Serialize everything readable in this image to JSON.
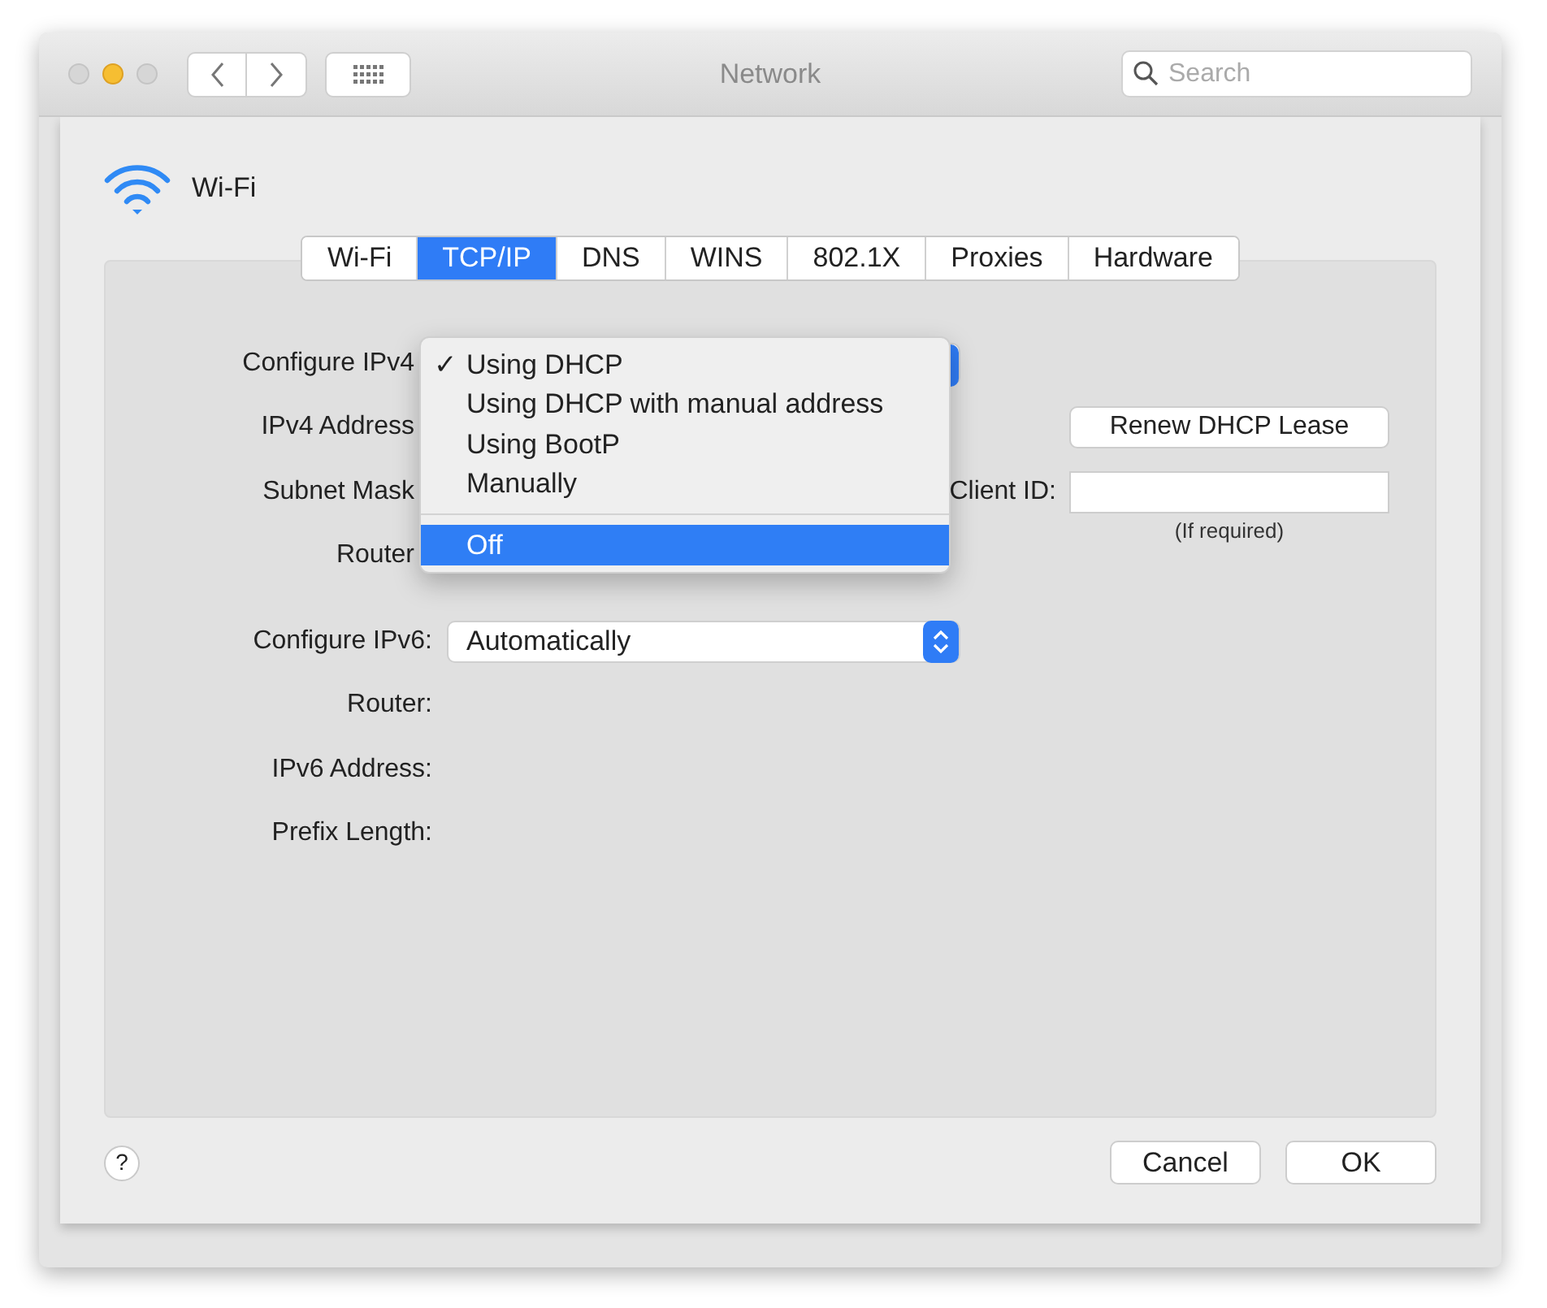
{
  "window": {
    "title": "Network",
    "traffic_lights": [
      {
        "kind": "close",
        "active": false
      },
      {
        "kind": "minimize",
        "active": true
      },
      {
        "kind": "zoom",
        "active": false
      }
    ]
  },
  "toolbar": {
    "search": {
      "placeholder": "Search"
    }
  },
  "service": {
    "name": "Wi-Fi"
  },
  "tabs": [
    {
      "label": "Wi-Fi",
      "selected": false
    },
    {
      "label": "TCP/IP",
      "selected": true
    },
    {
      "label": "DNS",
      "selected": false
    },
    {
      "label": "WINS",
      "selected": false
    },
    {
      "label": "802.1X",
      "selected": false
    },
    {
      "label": "Proxies",
      "selected": false
    },
    {
      "label": "Hardware",
      "selected": false
    }
  ],
  "ipv4": {
    "configure_label": "Configure IPv4",
    "address_label": "IPv4 Address",
    "subnet_label": "Subnet Mask",
    "router_label": "Router",
    "renew_button": "Renew DHCP Lease",
    "client_id_label": "Client ID:",
    "client_id_hint": "(If required)"
  },
  "ipv4_menu": [
    {
      "kind": "option",
      "label": "Using DHCP",
      "checked": true,
      "highlighted": false
    },
    {
      "kind": "option",
      "label": "Using DHCP with manual address",
      "checked": false,
      "highlighted": false
    },
    {
      "kind": "option",
      "label": "Using BootP",
      "checked": false,
      "highlighted": false
    },
    {
      "kind": "option",
      "label": "Manually",
      "checked": false,
      "highlighted": false
    },
    {
      "kind": "separator"
    },
    {
      "kind": "option",
      "label": "Off",
      "checked": false,
      "highlighted": true
    }
  ],
  "check_mark": "✓",
  "ipv6": {
    "configure_label": "Configure IPv6:",
    "configure_value": "Automatically",
    "router_label": "Router:",
    "address_label": "IPv6 Address:",
    "prefix_label": "Prefix Length:"
  },
  "footer": {
    "help": "?",
    "buttons": [
      "Cancel",
      "OK"
    ]
  }
}
